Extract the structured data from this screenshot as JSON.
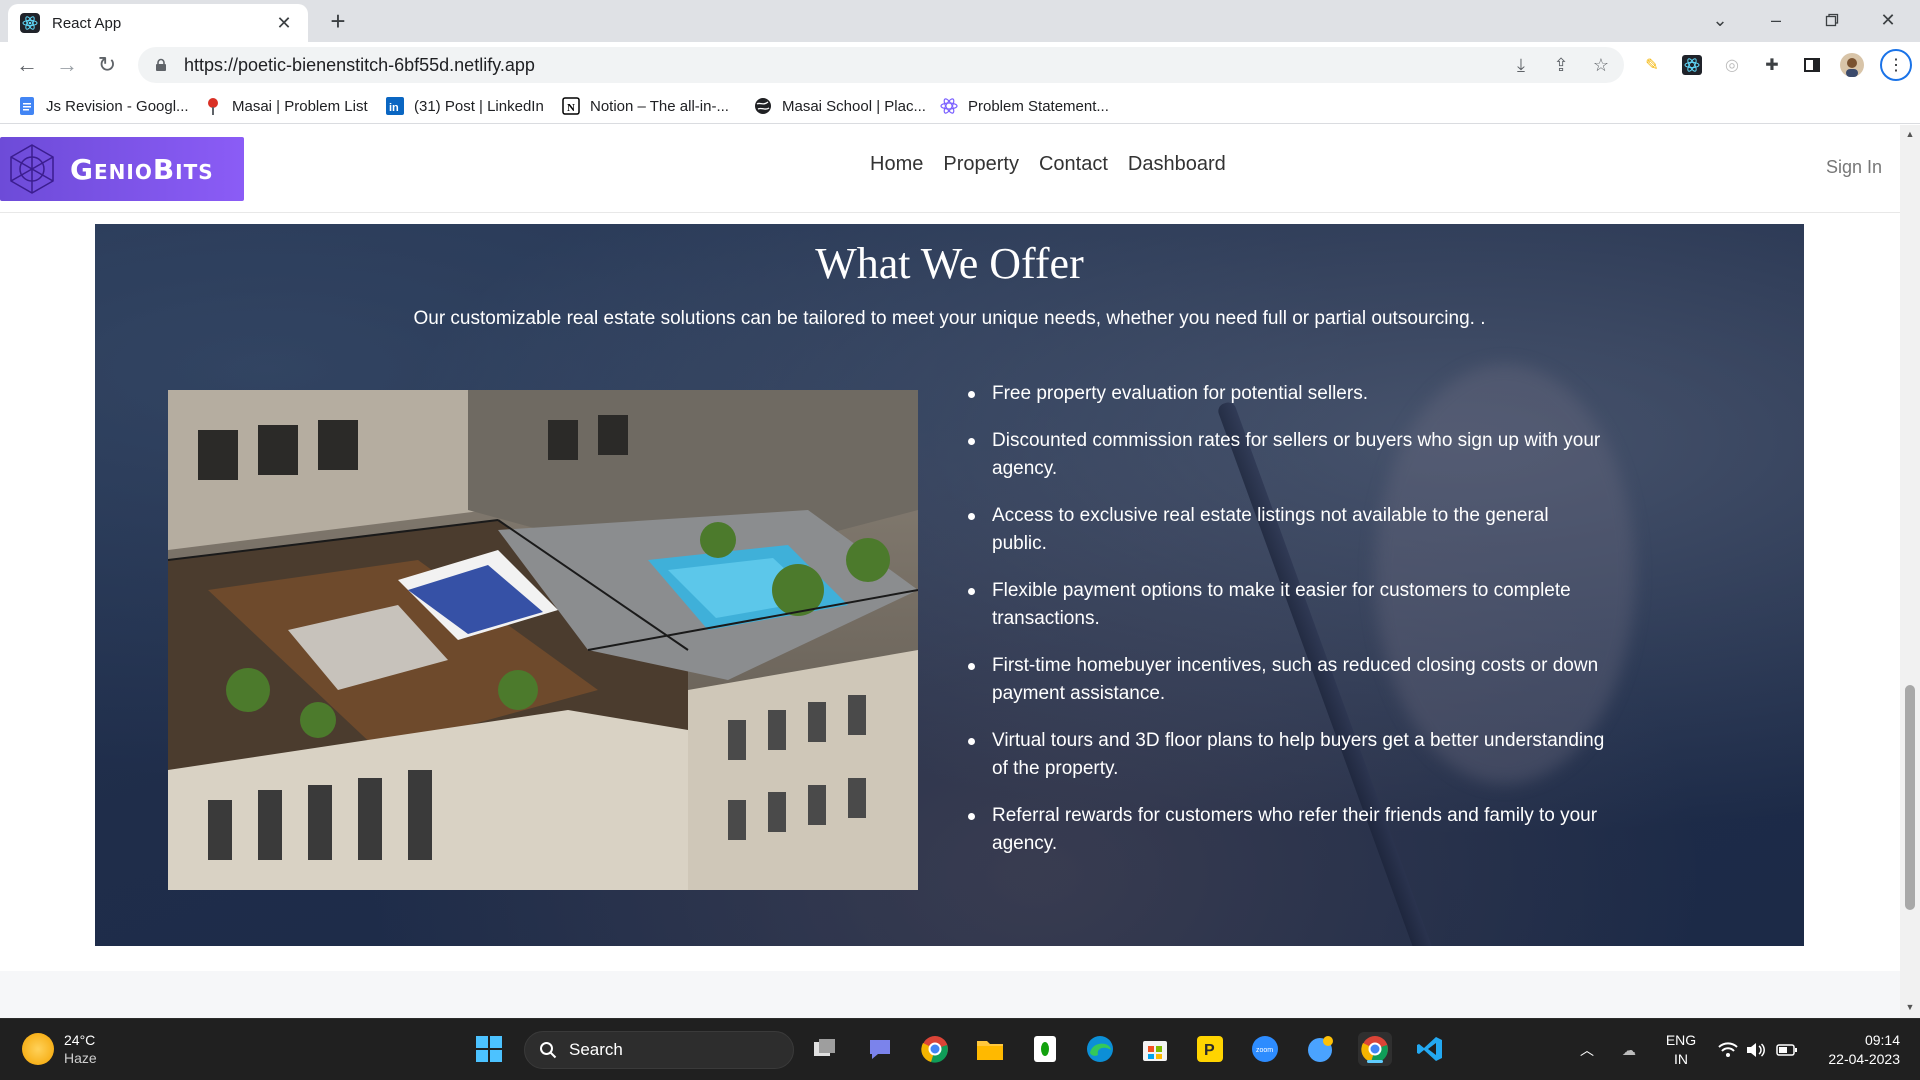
{
  "browser": {
    "tab_title": "React App",
    "url": "https://poetic-bienenstitch-6bf55d.netlify.app",
    "bookmarks": [
      {
        "label": "Js Revision - Googl...",
        "icon": "google-docs-icon"
      },
      {
        "label": "Masai | Problem List",
        "icon": "masai-icon"
      },
      {
        "label": "(31) Post | LinkedIn",
        "icon": "linkedin-icon"
      },
      {
        "label": "Notion – The all-in-...",
        "icon": "notion-icon"
      },
      {
        "label": "Masai School | Plac...",
        "icon": "globe-icon"
      },
      {
        "label": "Problem Statement...",
        "icon": "react-icon"
      }
    ]
  },
  "site": {
    "logo_text": "GenioBits",
    "nav": [
      {
        "label": "Home"
      },
      {
        "label": "Property"
      },
      {
        "label": "Contact"
      },
      {
        "label": "Dashboard"
      }
    ],
    "sign_in": "Sign In"
  },
  "offer": {
    "title": "What We Offer",
    "subtitle": "Our customizable real estate solutions can be tailored to meet your unique needs, whether you need full or partial outsourcing. .",
    "items": [
      "Free property evaluation for potential sellers.",
      "Discounted commission rates for sellers or buyers who sign up with your agency.",
      "Access to exclusive real estate listings not available to the general public.",
      "Flexible payment options to make it easier for customers to complete transactions.",
      "First-time homebuyer incentives, such as reduced closing costs or down payment assistance.",
      "Virtual tours and 3D floor plans to help buyers get a better understanding of the property.",
      "Referral rewards for customers who refer their friends and family to your agency."
    ]
  },
  "taskbar": {
    "temperature": "24°C",
    "weather": "Haze",
    "search_label": "Search",
    "lang_top": "ENG",
    "lang_bottom": "IN",
    "time": "09:14",
    "date": "22-04-2023"
  },
  "colors": {
    "logo_gradient_start": "#6d4bd8",
    "offer_background": "#1f2d4a",
    "taskbar": "#202020"
  }
}
